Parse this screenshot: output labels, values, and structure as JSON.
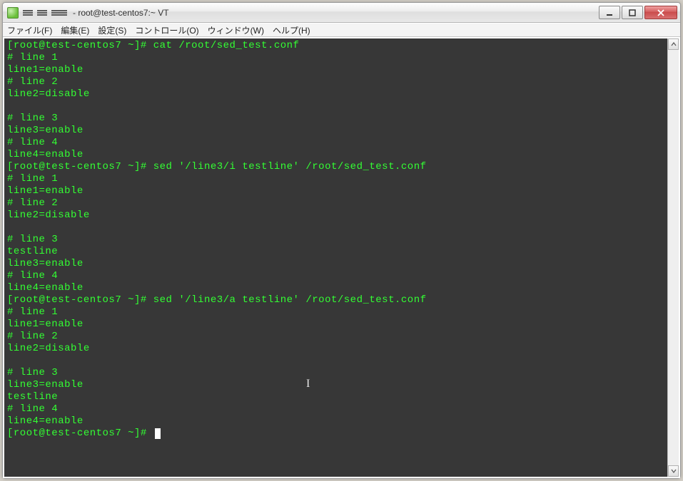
{
  "window": {
    "title": "- root@test-centos7:~ VT"
  },
  "menu": {
    "file": "ファイル(F)",
    "edit": "編集(E)",
    "settings": "設定(S)",
    "control": "コントロール(O)",
    "window": "ウィンドウ(W)",
    "help": "ヘルプ(H)"
  },
  "terminal": {
    "lines": [
      "[root@test-centos7 ~]# cat /root/sed_test.conf",
      "# line 1",
      "line1=enable",
      "# line 2",
      "line2=disable",
      "",
      "# line 3",
      "line3=enable",
      "# line 4",
      "line4=enable",
      "[root@test-centos7 ~]# sed '/line3/i testline' /root/sed_test.conf",
      "# line 1",
      "line1=enable",
      "# line 2",
      "line2=disable",
      "",
      "# line 3",
      "testline",
      "line3=enable",
      "# line 4",
      "line4=enable",
      "[root@test-centos7 ~]# sed '/line3/a testline' /root/sed_test.conf",
      "# line 1",
      "line1=enable",
      "# line 2",
      "line2=disable",
      "",
      "# line 3",
      "line3=enable",
      "testline",
      "# line 4",
      "line4=enable"
    ],
    "prompt_last": "[root@test-centos7 ~]# "
  }
}
